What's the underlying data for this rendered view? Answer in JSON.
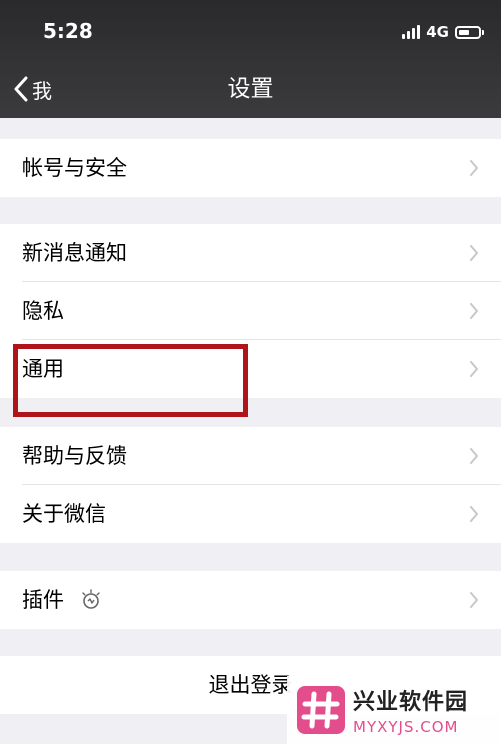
{
  "status_bar": {
    "time": "5:28",
    "network": "4G",
    "battery_level": 0.55
  },
  "nav": {
    "back_label": "我",
    "title": "设置"
  },
  "settings": {
    "account_security": "帐号与安全",
    "new_message_notification": "新消息通知",
    "privacy": "隐私",
    "general": "通用",
    "help_feedback": "帮助与反馈",
    "about_wechat": "关于微信",
    "plugins": "插件",
    "logout": "退出登录"
  },
  "annotation": {
    "highlight_color": "#b0141b"
  },
  "watermark": {
    "title": "兴业软件园",
    "domain": "MYXYJS.COM",
    "accent_color": "#e44d8c"
  },
  "icons": {
    "chevron": "chevron-right-icon",
    "back": "chevron-left-icon",
    "plugin_status": "lightbulb-icon"
  }
}
